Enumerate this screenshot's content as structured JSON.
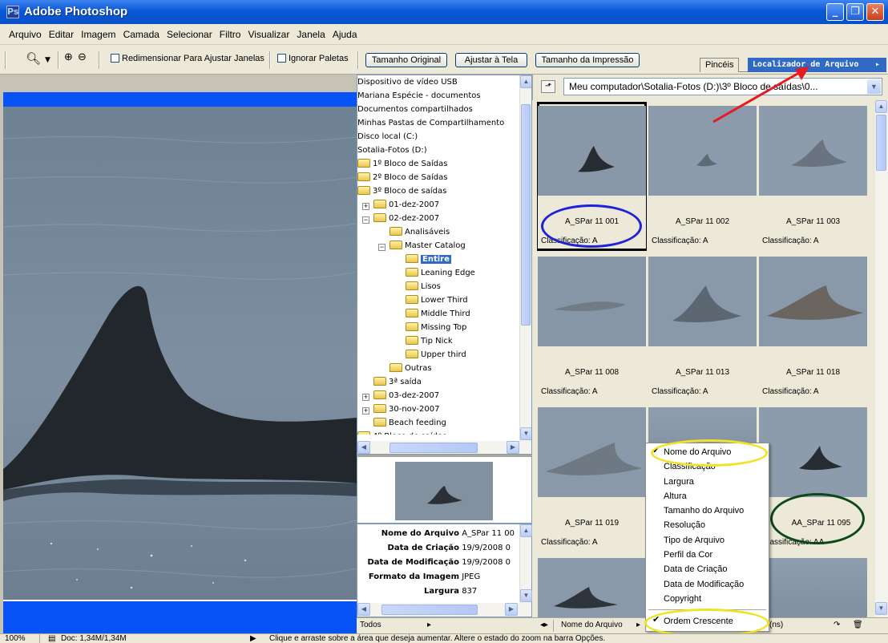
{
  "window": {
    "title": "Adobe Photoshop",
    "icon": "photoshop-icon",
    "controls": [
      "minimize-icon",
      "maximize-icon",
      "close-icon"
    ]
  },
  "menu": [
    "Arquivo",
    "Editar",
    "Imagem",
    "Camada",
    "Selecionar",
    "Filtro",
    "Visualizar",
    "Janela",
    "Ajuda"
  ],
  "options": {
    "resize_windows": "Redimensionar Para Ajustar Janelas",
    "ignore_palettes": "Ignorar Paletas",
    "actual_pixels": "Tamanho Original",
    "fit_screen": "Ajustar à Tela",
    "print_size": "Tamanho da Impressão"
  },
  "palette_tabs": {
    "brushes": "Pincéis",
    "file_browser": "Localizador de Arquivo"
  },
  "folder_tree": [
    {
      "label": "Dispositivo de vídeo USB"
    },
    {
      "label": "Mariana Espécie - documentos"
    },
    {
      "label": "Documentos compartilhados"
    },
    {
      "label": "Minhas Pastas de Compartilhamento"
    },
    {
      "label": "Disco local (C:)"
    },
    {
      "label": "Sotalia-Fotos (D:)"
    },
    {
      "label": "1º Bloco de Saídas"
    },
    {
      "label": "2º Bloco de Saídas"
    },
    {
      "label": "3º Bloco de saídas"
    },
    {
      "label": "01-dez-2007"
    },
    {
      "label": "02-dez-2007"
    },
    {
      "label": "Analisáveis"
    },
    {
      "label": "Master Catalog"
    },
    {
      "label": "Entire"
    },
    {
      "label": "Leaning Edge"
    },
    {
      "label": "Lisos"
    },
    {
      "label": "Lower Third"
    },
    {
      "label": "Middle Third"
    },
    {
      "label": "Missing Top"
    },
    {
      "label": "Tip Nick"
    },
    {
      "label": "Upper third"
    },
    {
      "label": "Outras"
    },
    {
      "label": "3ª saída"
    },
    {
      "label": "03-dez-2007"
    },
    {
      "label": "30-nov-2007"
    },
    {
      "label": "Beach feeding"
    },
    {
      "label": "4º Bloco de saídas"
    }
  ],
  "metadata": [
    {
      "key": "Nome do Arquivo",
      "value": "A_SPar 11 00"
    },
    {
      "key": "Data de Criação",
      "value": "19/9/2008 0"
    },
    {
      "key": "Data de Modificação",
      "value": "19/9/2008 0"
    },
    {
      "key": "Formato da Imagem",
      "value": "JPEG"
    },
    {
      "key": "Largura",
      "value": "837"
    }
  ],
  "left_bottom": {
    "filter": "Todos"
  },
  "browser": {
    "path": "Meu computador\\Sotalia-Fotos (D:)\\3º Bloco de saídas\\0..."
  },
  "thumbnails": [
    {
      "name": "A_SPar 11 001",
      "rating": "Classificação: A"
    },
    {
      "name": "A_SPar 11 002",
      "rating": "Classificação: A"
    },
    {
      "name": "A_SPar 11 003",
      "rating": "Classificação: A"
    },
    {
      "name": "A_SPar 11 008",
      "rating": "Classificação: A"
    },
    {
      "name": "A_SPar 11 013",
      "rating": "Classificação: A"
    },
    {
      "name": "A_SPar 11 018",
      "rating": "Classificação: A"
    },
    {
      "name": "A_SPar 11 019",
      "rating": "Classificação: A"
    },
    {
      "name": "",
      "rating": ""
    },
    {
      "name": "AA_SPar 11 095",
      "rating": "Classificação: AA"
    }
  ],
  "sort_menu": {
    "items": [
      "Nome do Arquivo",
      "Classificação",
      "Largura",
      "Altura",
      "Tamanho do Arquivo",
      "Resolução",
      "Tipo de Arquivo",
      "Perfil da Cor",
      "Data de Criação",
      "Data de Modificação",
      "Copyright"
    ],
    "ascending": "Ordem Crescente"
  },
  "right_bottom": {
    "sort_by": "Nome do Arquivo",
    "count_suffix": "(ns)"
  },
  "status": {
    "zoom": "100%",
    "doc": "Doc: 1,34M/1,34M",
    "hint": "Clique e arraste sobre a área que deseja aumentar. Altere o estado do zoom na barra Opções."
  },
  "colors": {
    "title_bar": "#0a58d6",
    "selection": "#316ac5",
    "annotation_red": "#e8191f",
    "annotation_blue": "#1e22d8",
    "annotation_yellow": "#f2e227",
    "annotation_green": "#0c4818"
  }
}
